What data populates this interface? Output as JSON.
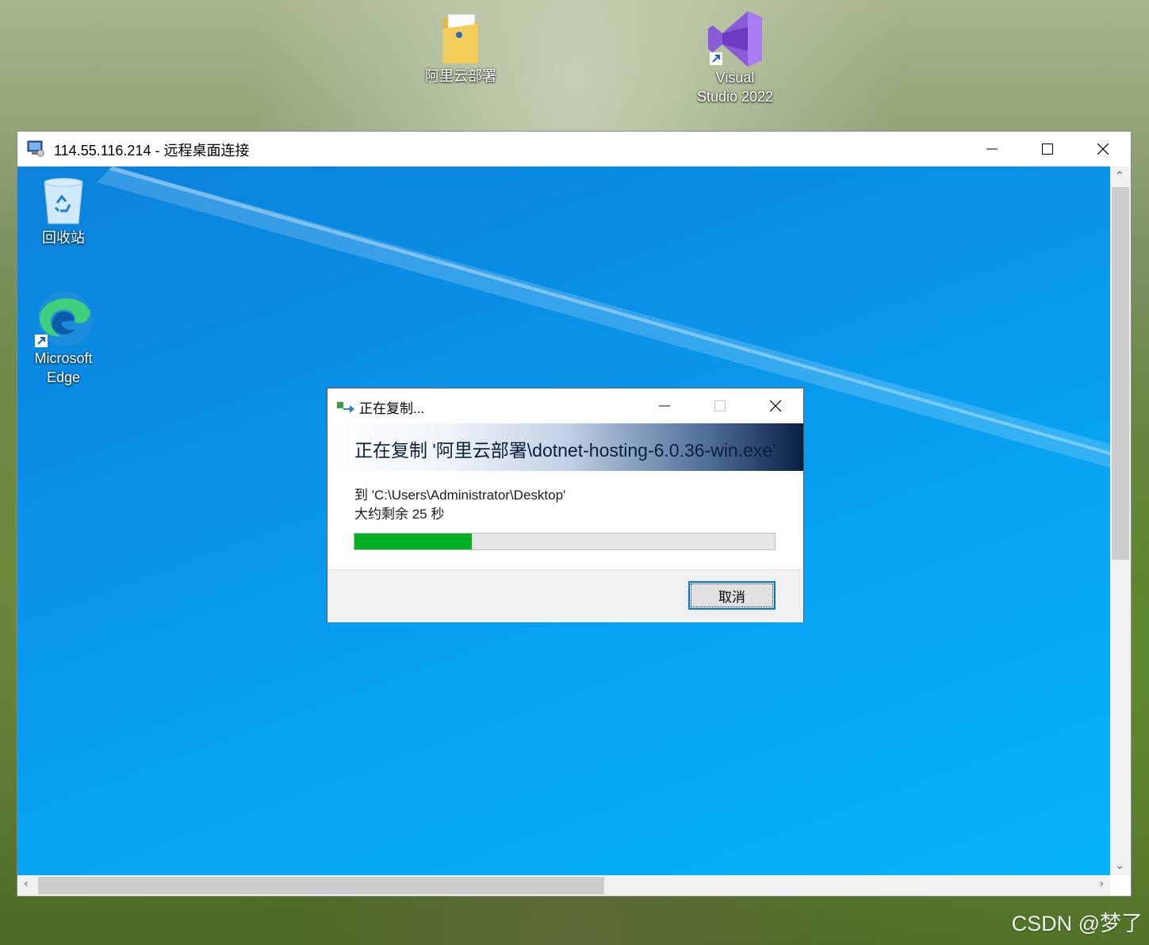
{
  "desktop": {
    "icons": [
      {
        "label": "阿里云部署",
        "icon": "folder-icon"
      },
      {
        "label": "Visual\nStudio 2022",
        "icon": "visual-studio-icon"
      }
    ]
  },
  "rdp_window": {
    "title": "114.55.116.214 - 远程桌面连接",
    "icon": "remote-desktop-icon",
    "remote_desktop": {
      "icons": [
        {
          "label": "回收站",
          "icon": "recycle-bin-icon"
        },
        {
          "label": "Microsoft\nEdge",
          "icon": "edge-icon"
        }
      ]
    }
  },
  "copy_dialog": {
    "title": "正在复制...",
    "heading": "正在复制 '阿里云部署\\dotnet-hosting-6.0.36-win.exe'",
    "destination": "到 'C:\\Users\\Administrator\\Desktop'",
    "remaining": "大约剩余 25 秒",
    "progress_fraction": 0.28,
    "cancel_label": "取消",
    "progress_color": "#06b025"
  },
  "watermark": "CSDN @梦了"
}
